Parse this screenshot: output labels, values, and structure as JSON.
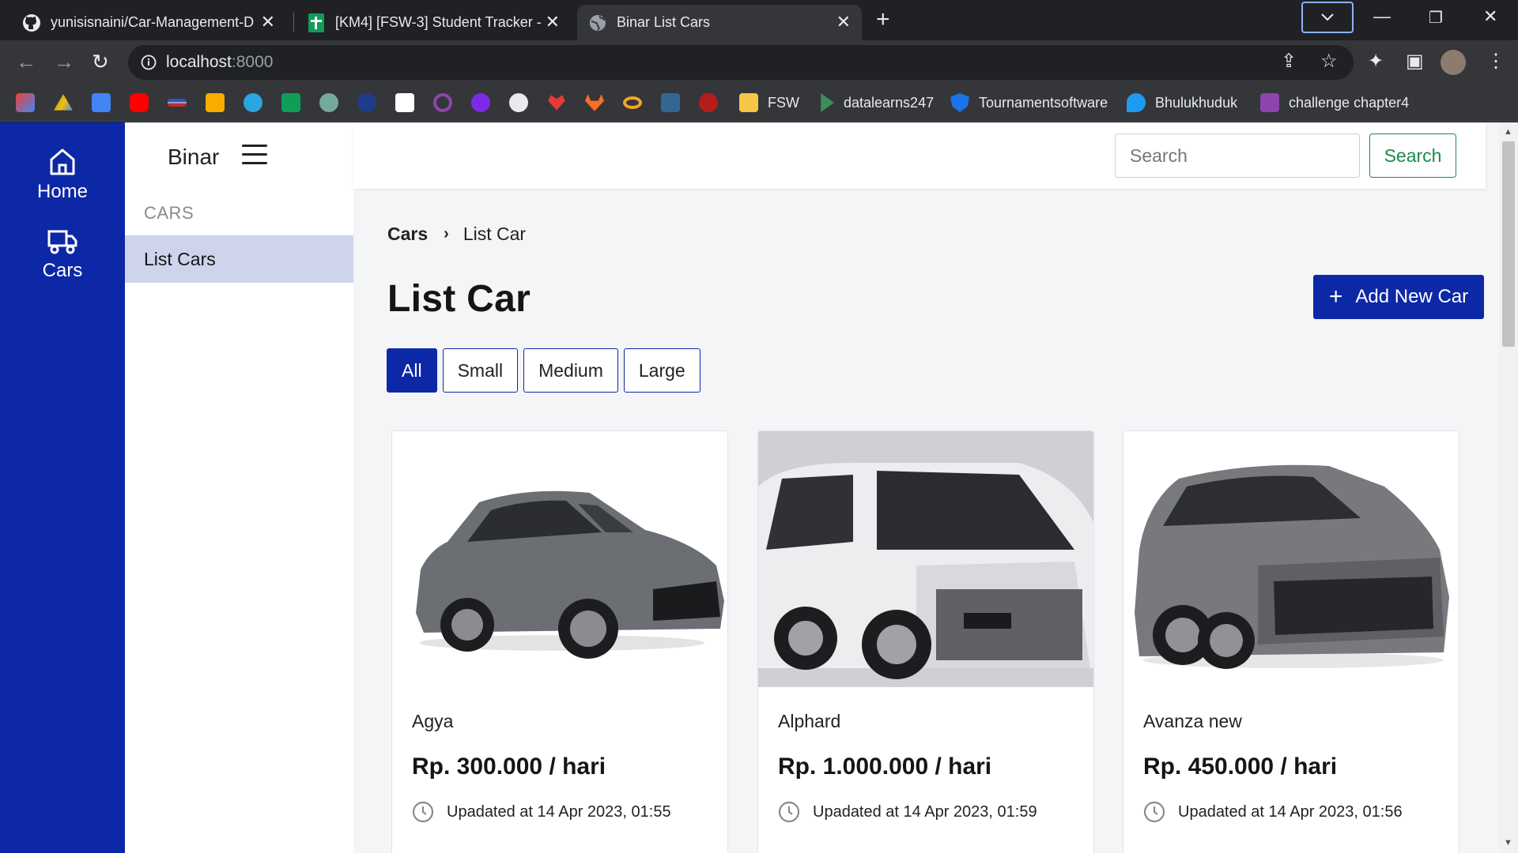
{
  "browser": {
    "tabs": [
      {
        "title": "yunisisnaini/Car-Management-D",
        "icon": "github-icon"
      },
      {
        "title": "[KM4] [FSW-3] Student Tracker -",
        "icon": "sheets-icon"
      },
      {
        "title": "Binar List Cars",
        "icon": "globe-icon"
      }
    ],
    "url_host": "localhost",
    "url_port": ":8000",
    "bookmarks": [
      {
        "label": "FSW",
        "color": "#f6c744"
      },
      {
        "label": "datalearns247",
        "color": "#3a8f5c"
      },
      {
        "label": "Tournamentsoftware",
        "color": "#1a73e8"
      },
      {
        "label": "Bhulukhuduk",
        "color": "#1d9bf0"
      },
      {
        "label": "challenge chapter4",
        "color": "#8e44ad"
      }
    ]
  },
  "rail": {
    "home_label": "Home",
    "cars_label": "Cars"
  },
  "sidebar": {
    "brand": "Binar",
    "section_label": "CARS",
    "items": [
      {
        "label": "List Cars"
      }
    ]
  },
  "topnav": {
    "search_placeholder": "Search",
    "search_button": "Search"
  },
  "breadcrumb": {
    "first": "Cars",
    "current": "List Car"
  },
  "main": {
    "title": "List Car",
    "add_button": "Add New Car",
    "filters": [
      "All",
      "Small",
      "Medium",
      "Large"
    ],
    "active_filter": "All"
  },
  "cars": [
    {
      "name": "Agya",
      "price": "Rp. 300.000 / hari",
      "updated": "Upadated at 14 Apr 2023, 01:55",
      "color": "#6b6e73"
    },
    {
      "name": "Alphard",
      "price": "Rp. 1.000.000 / hari",
      "updated": "Upadated at 14 Apr 2023, 01:59",
      "color": "#e4e5e7"
    },
    {
      "name": "Avanza new",
      "price": "Rp. 450.000 / hari",
      "updated": "Upadated at 14 Apr 2023, 01:56",
      "color": "#77797d"
    }
  ],
  "colors": {
    "brand_blue": "#0d28a6",
    "sidebar_active": "#cfd4ed",
    "search_green": "#1c8a4a"
  }
}
